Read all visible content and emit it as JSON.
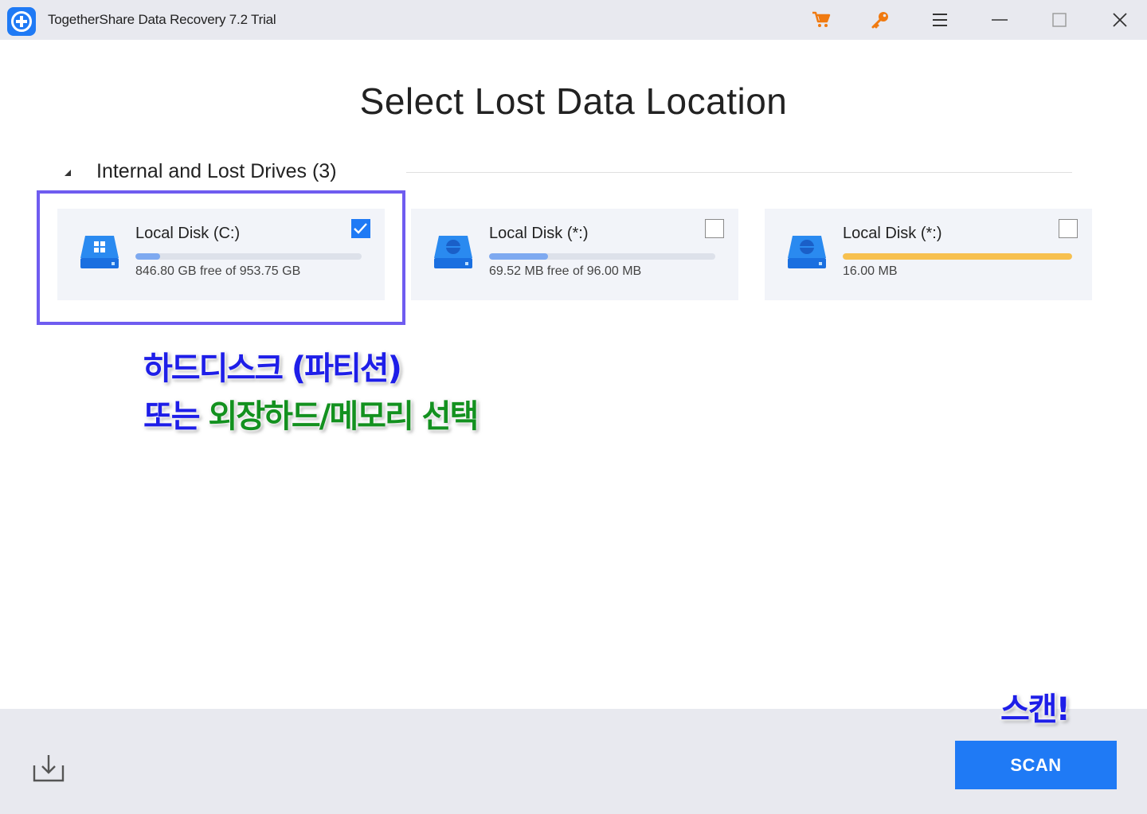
{
  "window": {
    "title": "TogetherShare Data Recovery 7.2 Trial",
    "icons": [
      "app-logo-icon",
      "cart-icon",
      "key-icon",
      "menu-icon",
      "minimize-icon",
      "maximize-icon",
      "close-icon"
    ],
    "accent_color": "#1f7af5"
  },
  "main": {
    "title": "Select Lost Data Location",
    "section": {
      "title": "Internal and Lost Drives (3)",
      "expanded": true
    },
    "drives": [
      {
        "name": "Local Disk (C:)",
        "info": "846.80 GB free of 953.75 GB",
        "used_fraction": 0.11,
        "bar_color": "#7ea9f0",
        "checked": true,
        "icon": "windows-drive-icon"
      },
      {
        "name": "Local Disk (*:)",
        "info": "69.52 MB free of 96.00 MB",
        "used_fraction": 0.26,
        "bar_color": "#7ea9f0",
        "checked": false,
        "icon": "drive-icon"
      },
      {
        "name": "Local Disk (*:)",
        "info": "16.00 MB",
        "used_fraction": 1.0,
        "bar_color": "#f7c04f",
        "checked": false,
        "icon": "drive-icon"
      }
    ]
  },
  "annotations": {
    "line1": "하드디스크 (파티션)",
    "line2_a": "또는 ",
    "line2_b": "외장하드/메모리 선택",
    "scan": "스캔!",
    "highlight_color": "#6f5cf0"
  },
  "footer": {
    "scan_label": "SCAN",
    "export_icon": "export-icon"
  }
}
